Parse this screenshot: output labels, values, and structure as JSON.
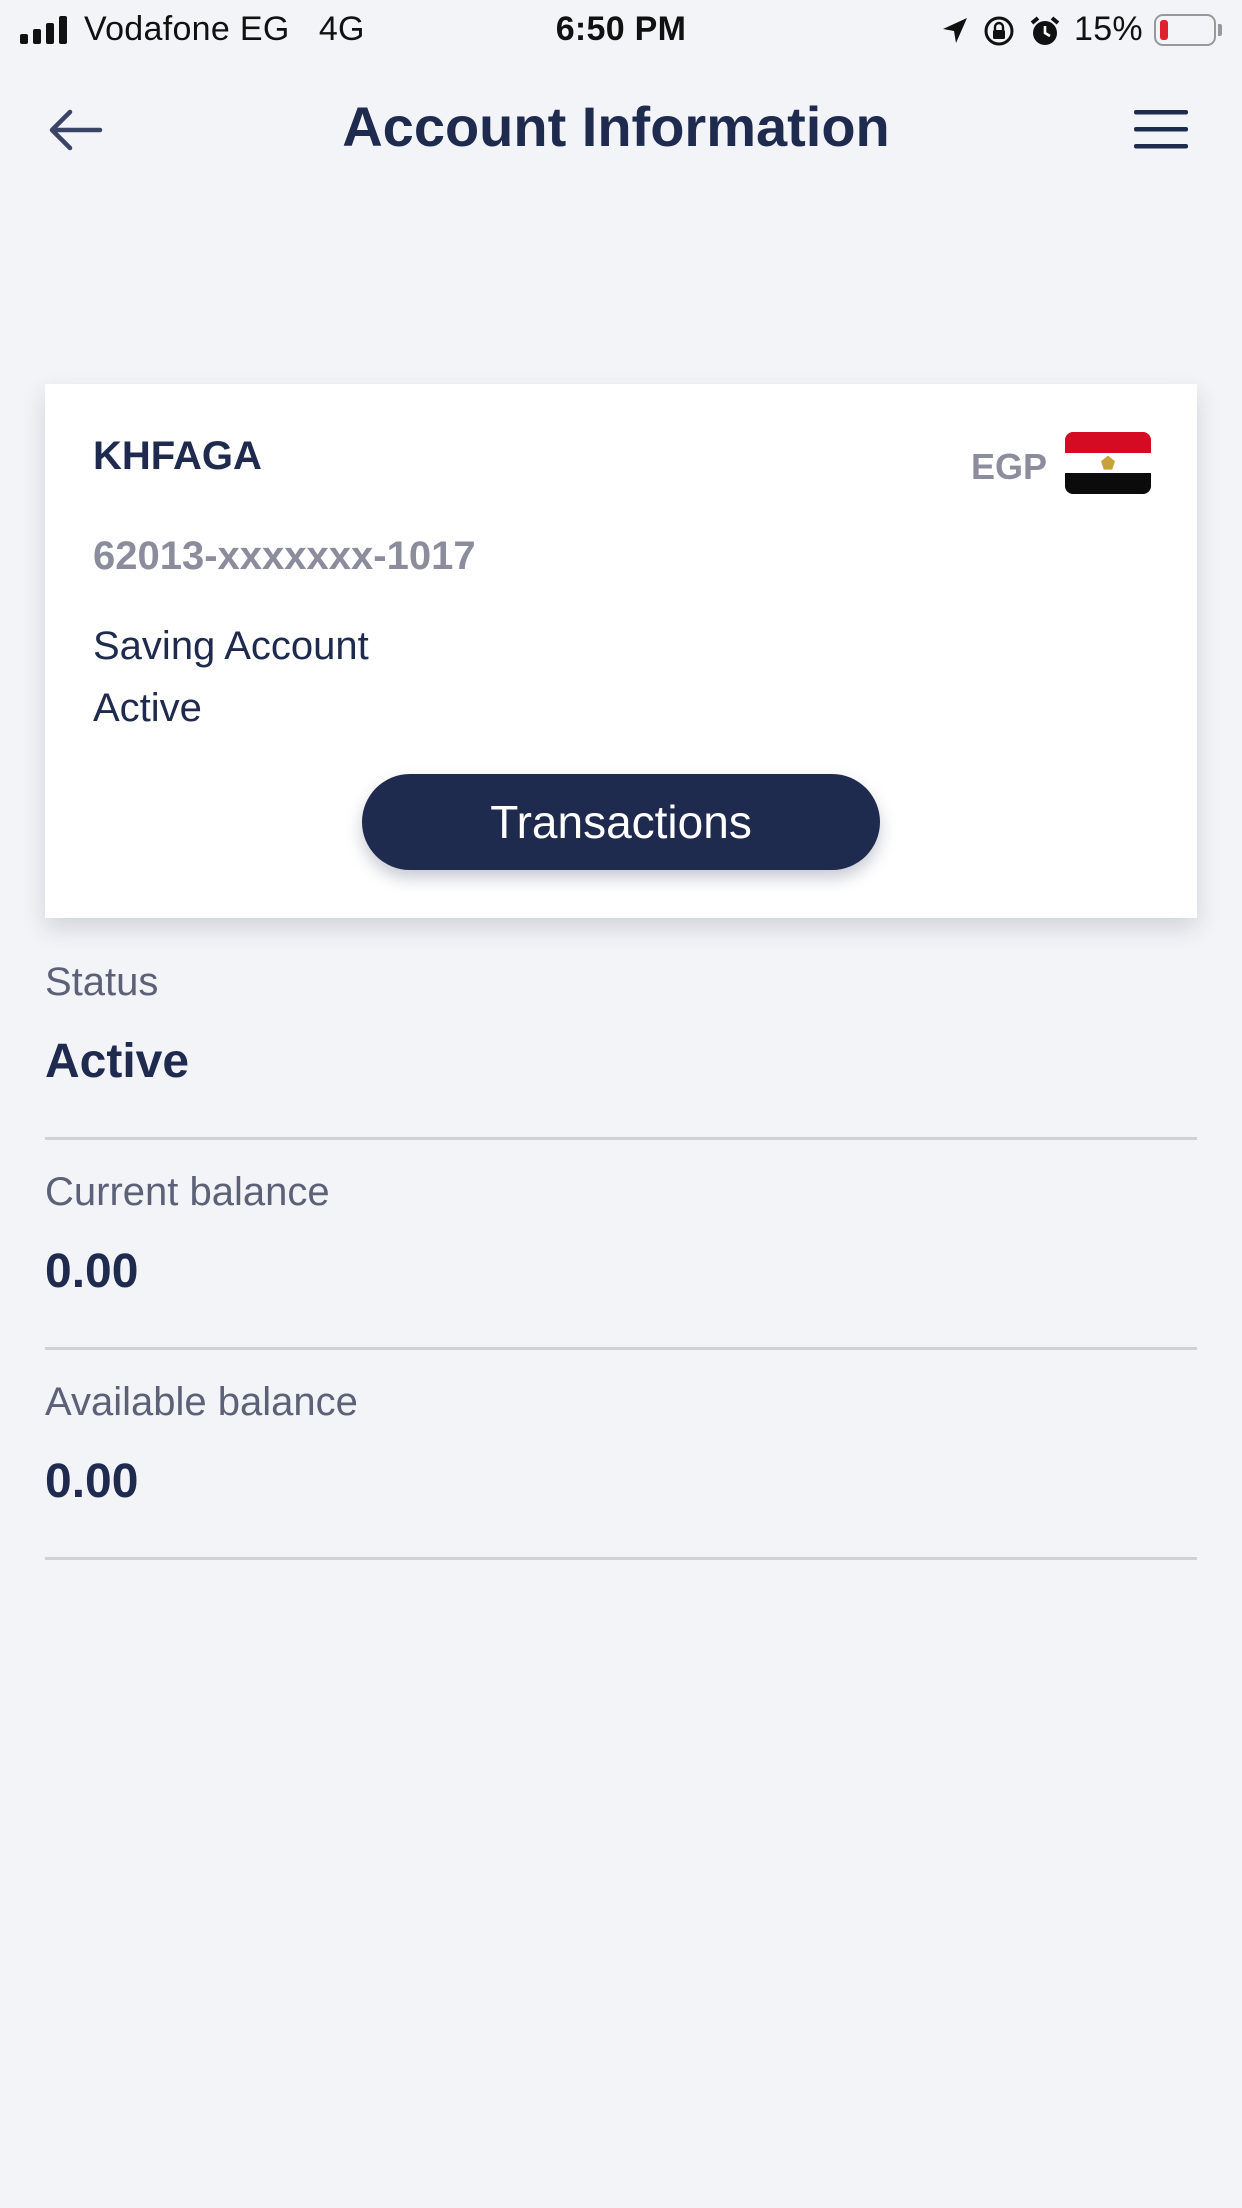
{
  "status_bar": {
    "carrier": "Vodafone EG",
    "network": "4G",
    "time": "6:50 PM",
    "battery_percent": "15%",
    "icons": [
      "signal-icon",
      "location-arrow-icon",
      "orientation-lock-icon",
      "alarm-icon",
      "battery-icon"
    ]
  },
  "header": {
    "title": "Account Information",
    "back_icon": "arrow-left-icon",
    "menu_icon": "hamburger-menu-icon"
  },
  "account_card": {
    "name": "KHFAGA",
    "currency": "EGP",
    "flag_icon": "egypt-flag-icon",
    "number": "62013-xxxxxxx-1017",
    "type": "Saving Account",
    "status": "Active",
    "transactions_button": "Transactions"
  },
  "details": [
    {
      "label": "Status",
      "value": "Active"
    },
    {
      "label": "Current balance",
      "value": "0.00"
    },
    {
      "label": "Available balance",
      "value": "0.00"
    }
  ],
  "colors": {
    "background": "#f3f4f7",
    "primary": "#1f2a4f",
    "muted": "#8c8d9c",
    "label": "#5d6178",
    "divider": "#cfd1d6",
    "battery_low": "#e0202d"
  }
}
